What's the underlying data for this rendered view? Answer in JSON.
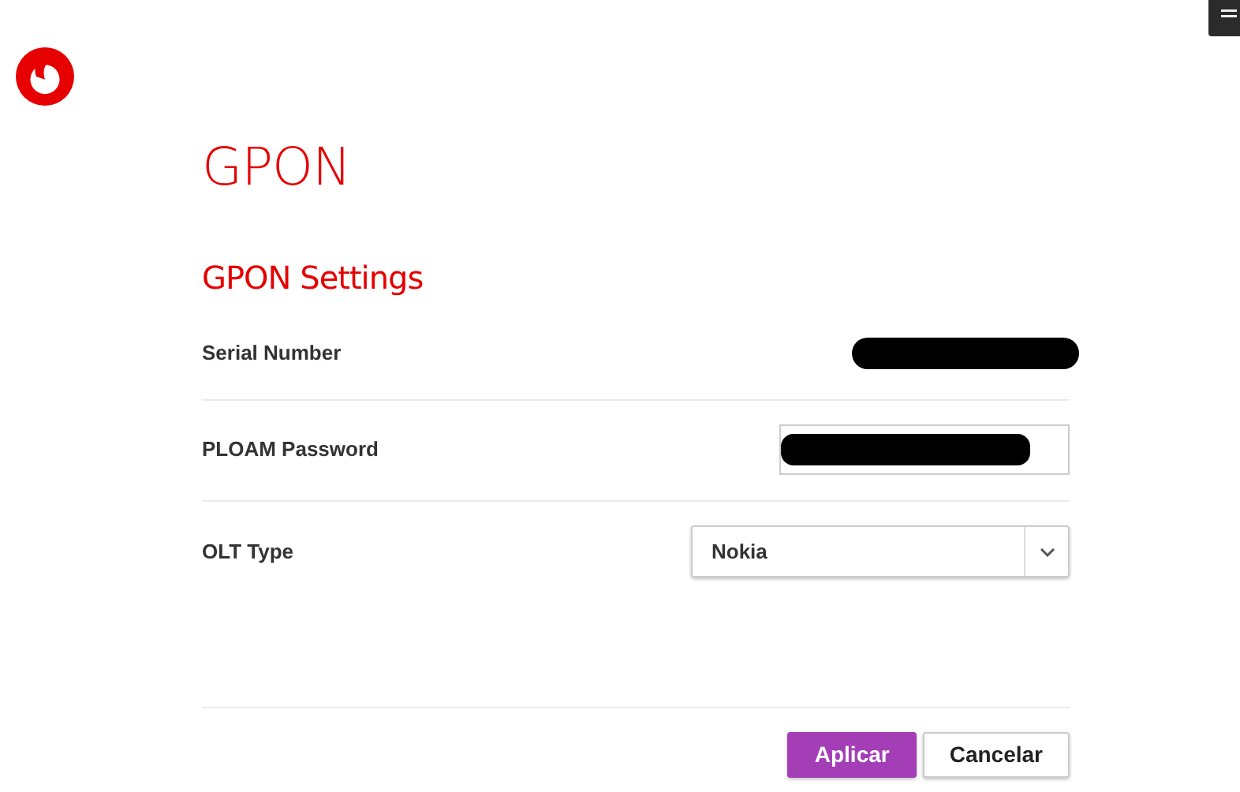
{
  "page": {
    "title": "GPON",
    "section_title": "GPON Settings"
  },
  "rows": [
    {
      "label": "Serial Number",
      "kind": "static",
      "redacted": true
    },
    {
      "label": "PLOAM Password",
      "kind": "input",
      "redacted": true
    },
    {
      "label": "OLT Type",
      "kind": "select",
      "value": "Nokia"
    }
  ],
  "buttons": [
    {
      "label": "Aplicar",
      "kind": "primary"
    },
    {
      "label": "Cancelar",
      "kind": "secondary"
    }
  ]
}
